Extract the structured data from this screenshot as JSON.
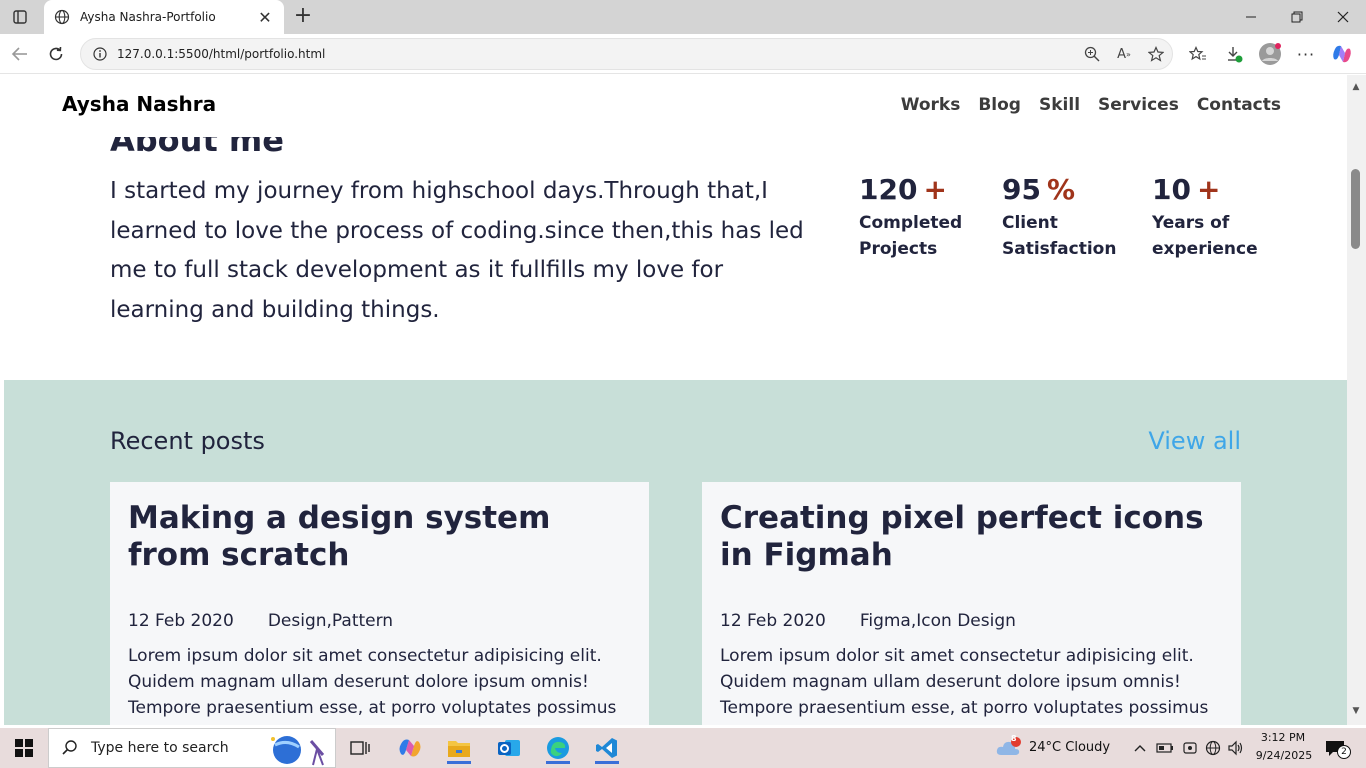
{
  "browser": {
    "tab_title": "Aysha Nashra-Portfolio",
    "url": "127.0.0.1:5500/html/portfolio.html"
  },
  "site": {
    "brand": "Aysha Nashra",
    "nav": [
      "Works",
      "Blog",
      "Skill",
      "Services",
      "Contacts"
    ]
  },
  "about": {
    "title": "About me",
    "text": "I started my journey from highschool days.Through that,I learned to love the process of coding.since then,this has led me to full stack development as it fullfills my love for learning and building things.",
    "stats": [
      {
        "number": "120",
        "suffix": "+",
        "label": "Completed Projects"
      },
      {
        "number": "95",
        "suffix": "%",
        "label": "Client Satisfaction"
      },
      {
        "number": "10",
        "suffix": "+",
        "label": "Years of experience"
      }
    ]
  },
  "posts": {
    "title": "Recent posts",
    "view_all": "View all",
    "items": [
      {
        "title": "Making a design system from scratch",
        "date": "12 Feb 2020",
        "tags": "Design,Pattern",
        "body": "Lorem ipsum dolor sit amet consectetur adipisicing elit. Quidem magnam ullam deserunt dolore ipsum omnis! Tempore praesentium esse, at porro voluptates possimus voluptatum cum libero dolorem nemo adipisci tempora."
      },
      {
        "title": "Creating pixel perfect icons in Figmah",
        "date": "12 Feb 2020",
        "tags": "Figma,Icon Design",
        "body": "Lorem ipsum dolor sit amet consectetur adipisicing elit. Quidem magnam ullam deserunt dolore ipsum omnis! Tempore praesentium esse, at porro voluptates possimus voluptatum cum libero dolorem nemo adipisci tempora."
      }
    ]
  },
  "taskbar": {
    "search_placeholder": "Type here to search",
    "weather": "24°C  Cloudy",
    "weather_badge": "8",
    "time": "3:12 PM",
    "date": "9/24/2025",
    "notifications": "2"
  },
  "colors": {
    "accent_orange": "#a0341b",
    "posts_bg": "#c8dfd8",
    "link_blue": "#3fa6e8"
  }
}
